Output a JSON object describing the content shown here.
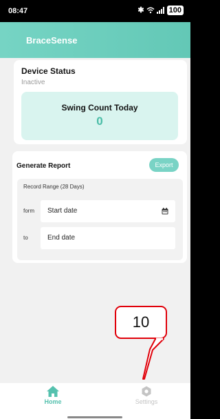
{
  "status_bar": {
    "time": "08:47",
    "battery": "100",
    "icons": [
      "bluetooth-icon",
      "wifi-icon",
      "signal-icon",
      "battery-icon"
    ]
  },
  "header": {
    "title": "BraceSense"
  },
  "device_status": {
    "title": "Device Status",
    "state": "Inactive",
    "swing_label": "Swing Count Today",
    "swing_value": "0"
  },
  "report": {
    "title": "Generate Report",
    "export_label": "Export",
    "range_label": "Record Range (28 Days)",
    "from_label": "form",
    "from_placeholder": "Start date",
    "to_label": "to",
    "to_placeholder": "End date"
  },
  "annotation": {
    "number": "10"
  },
  "nav": {
    "home_label": "Home",
    "settings_label": "Settings"
  },
  "colors": {
    "accent": "#63c8b6",
    "highlight_box": "#d9f4ef",
    "annotation_red": "#e0000a",
    "inactive_nav": "#c4c4c4"
  }
}
